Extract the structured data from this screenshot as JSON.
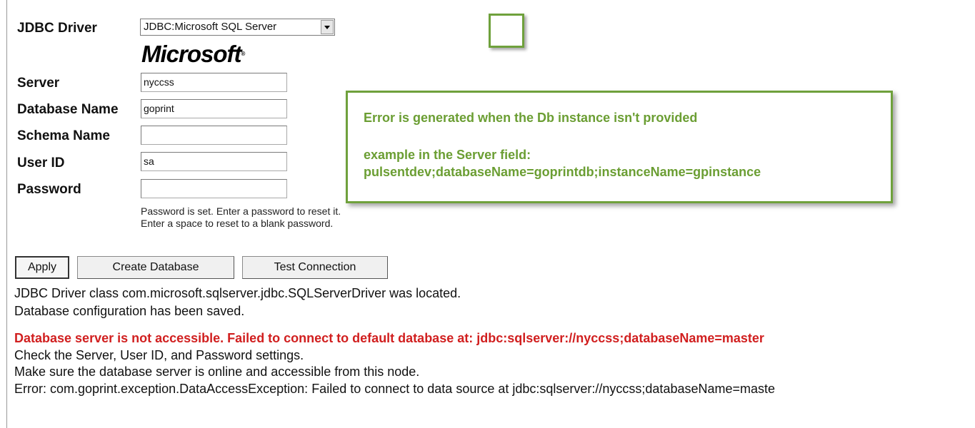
{
  "form": {
    "driver_label": "JDBC Driver",
    "driver_value": "JDBC:Microsoft SQL Server",
    "logo_text": "Microsoft",
    "logo_mark": "®",
    "server_label": "Server",
    "server_value": "nyccss",
    "database_label": "Database Name",
    "database_value": "goprint",
    "schema_label": "Schema Name",
    "schema_value": "",
    "userid_label": "User ID",
    "userid_value": "sa",
    "password_label": "Password",
    "password_value": "",
    "password_hint_1": "Password is set. Enter a password to reset it.",
    "password_hint_2": "Enter a space to reset to a blank password."
  },
  "buttons": {
    "apply": "Apply",
    "create_database": "Create Database",
    "test_connection": "Test Connection"
  },
  "messages": {
    "driver_located": "JDBC Driver class com.microsoft.sqlserver.jdbc.SQLServerDriver was located.",
    "config_saved": "Database configuration has been saved.",
    "error_title": "Database server is not accessible. Failed to connect to default database at: jdbc:sqlserver://nyccss;databaseName=master",
    "check_settings": "Check the Server, User ID, and Password settings.",
    "make_sure": "Make sure the database server is online and accessible from this node.",
    "error_detail": "Error: com.goprint.exception.DataAccessException: Failed to connect to data source at jdbc:sqlserver://nyccss;databaseName=maste"
  },
  "callout": {
    "line1": "Error is generated when the Db instance isn't provided",
    "line2": "example in the Server field:",
    "line3": "pulsentdev;databaseName=goprintdb;instanceName=gpinstance"
  },
  "colors": {
    "error_red": "#d11f1f",
    "callout_green": "#6b9e33",
    "callout_border": "#6fa13c"
  },
  "icons": {
    "dropdown": "chevron-down-icon"
  }
}
